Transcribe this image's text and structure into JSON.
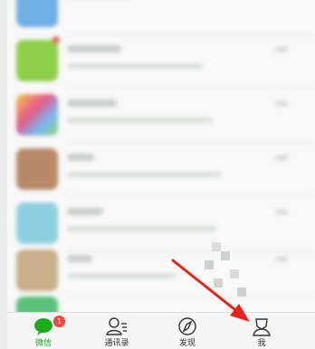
{
  "tabs": [
    {
      "label": "微信",
      "icon": "chat-bubble-icon",
      "active": true,
      "badge": "1"
    },
    {
      "label": "通讯录",
      "icon": "contacts-icon",
      "active": false
    },
    {
      "label": "发现",
      "icon": "compass-icon",
      "active": false
    },
    {
      "label": "我",
      "icon": "person-icon",
      "active": false
    }
  ],
  "colors": {
    "accent": "#1aad19",
    "badge": "#f04a3e",
    "arrow": "#e8221b"
  }
}
